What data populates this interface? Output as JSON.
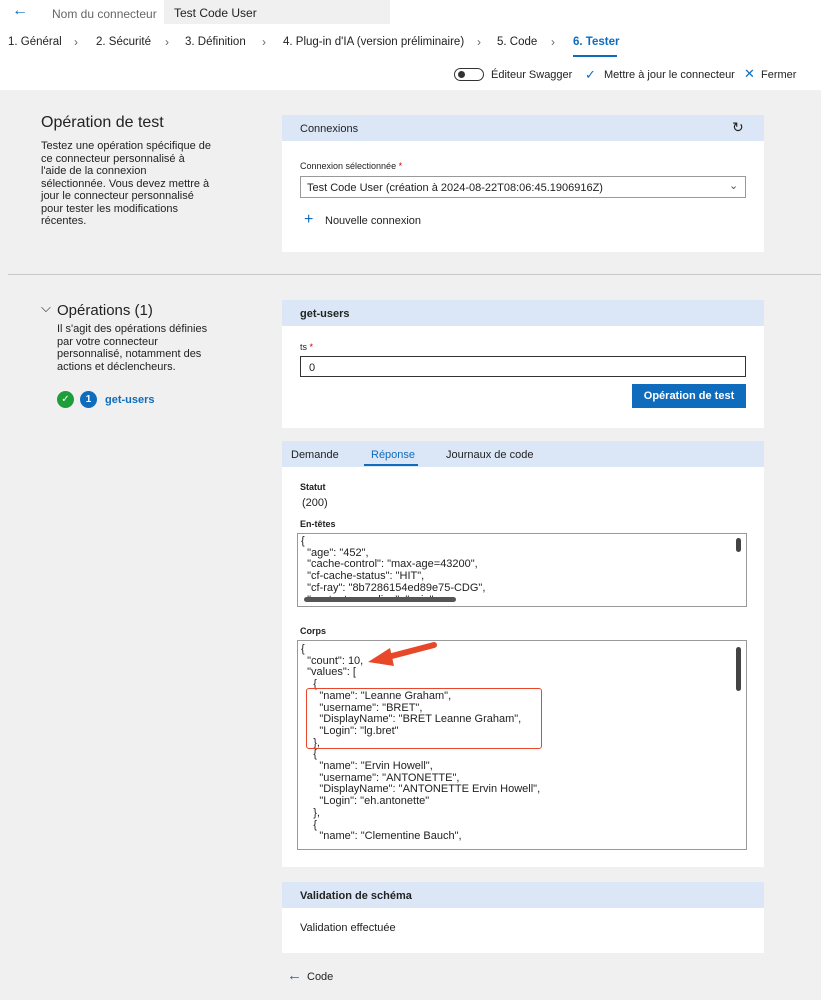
{
  "header": {
    "connector_name_label": "Nom du connecteur",
    "connector_name_value": "Test Code User"
  },
  "steps": [
    {
      "label": "1. Général"
    },
    {
      "label": "2. Sécurité"
    },
    {
      "label": "3. Définition"
    },
    {
      "label": "4. Plug-in d'IA (version préliminaire)"
    },
    {
      "label": "5. Code"
    },
    {
      "label": "6. Tester"
    }
  ],
  "toolbar": {
    "swagger_label": "Éditeur Swagger",
    "update_label": "Mettre à jour le connecteur",
    "close_label": "Fermer"
  },
  "test_op": {
    "title": "Opération de test",
    "desc_lines": [
      "Testez une opération spécifique de",
      "ce connecteur personnalisé à",
      "l'aide de la connexion",
      "sélectionnée. Vous devez mettre à",
      "jour le connecteur personnalisé",
      "pour tester les modifications",
      "récentes."
    ]
  },
  "connections": {
    "title": "Connexions",
    "selected_label": "Connexion sélectionnée",
    "required_mark": "*",
    "selected_value": "Test Code User (création à 2024-08-22T08:06:45.1906916Z)",
    "new_connection": "Nouvelle connexion"
  },
  "operations": {
    "title": "Opérations (1)",
    "desc_lines": [
      "Il s'agit des opérations définies",
      "par votre connecteur",
      "personnalisé, notamment des",
      "actions et déclencheurs."
    ],
    "item_number": "1",
    "item_label": "get-users"
  },
  "get_users": {
    "title": "get-users",
    "param_label": "ts",
    "required_mark": "*",
    "param_value": "0",
    "test_button": "Opération de test"
  },
  "response": {
    "tabs": [
      "Demande",
      "Réponse",
      "Journaux de code"
    ],
    "active_tab": "Réponse",
    "status_label": "Statut",
    "status_value": "(200)",
    "headers_label": "En-têtes",
    "headers_json": "{\n  \"age\": \"452\",\n  \"cache-control\": \"max-age=43200\",\n  \"cf-cache-status\": \"HIT\",\n  \"cf-ray\": \"8b7286154ed89e75-CDG\",\n  \"content-encoding\": \"gzip\",",
    "body_label": "Corps",
    "body_json": "{\n  \"count\": 10,\n  \"values\": [\n    {\n      \"name\": \"Leanne Graham\",\n      \"username\": \"BRET\",\n      \"DisplayName\": \"BRET Leanne Graham\",\n      \"Login\": \"lg.bret\"\n    },\n    {\n      \"name\": \"Ervin Howell\",\n      \"username\": \"ANTONETTE\",\n      \"DisplayName\": \"ANTONETTE Ervin Howell\",\n      \"Login\": \"eh.antonette\"\n    },\n    {\n      \"name\": \"Clementine Bauch\","
  },
  "schema": {
    "title": "Validation de schéma",
    "result": "Validation effectuée"
  },
  "footer": {
    "back_label": "Code"
  },
  "colors": {
    "accent": "#0f6cbd",
    "section_header": "#dbe7f7",
    "annotation": "#e8472a",
    "success": "#1e9e3a"
  }
}
